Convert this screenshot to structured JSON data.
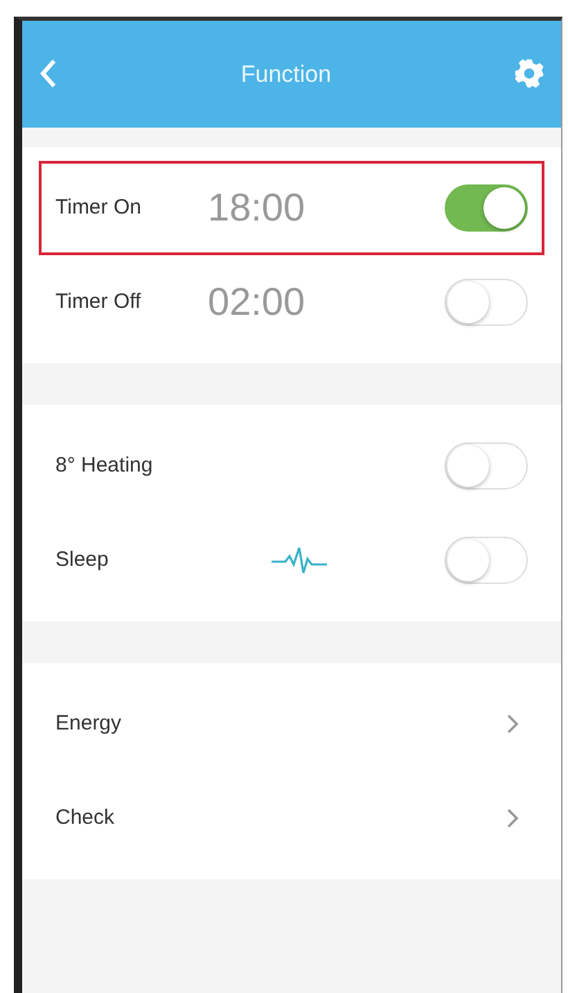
{
  "header": {
    "title": "Function"
  },
  "sections": [
    {
      "items": [
        {
          "kind": "timer",
          "label": "Timer On",
          "time": "18:00",
          "on": true,
          "highlighted": true
        },
        {
          "kind": "timer",
          "label": "Timer Off",
          "time": "02:00",
          "on": false,
          "highlighted": false
        }
      ]
    },
    {
      "items": [
        {
          "kind": "switch",
          "label": "8° Heating",
          "on": false,
          "highlighted": false
        },
        {
          "kind": "sleep",
          "label": "Sleep",
          "on": false,
          "highlighted": false
        }
      ]
    },
    {
      "items": [
        {
          "kind": "link",
          "label": "Energy",
          "highlighted": false
        },
        {
          "kind": "link",
          "label": "Check",
          "highlighted": false
        }
      ]
    }
  ]
}
